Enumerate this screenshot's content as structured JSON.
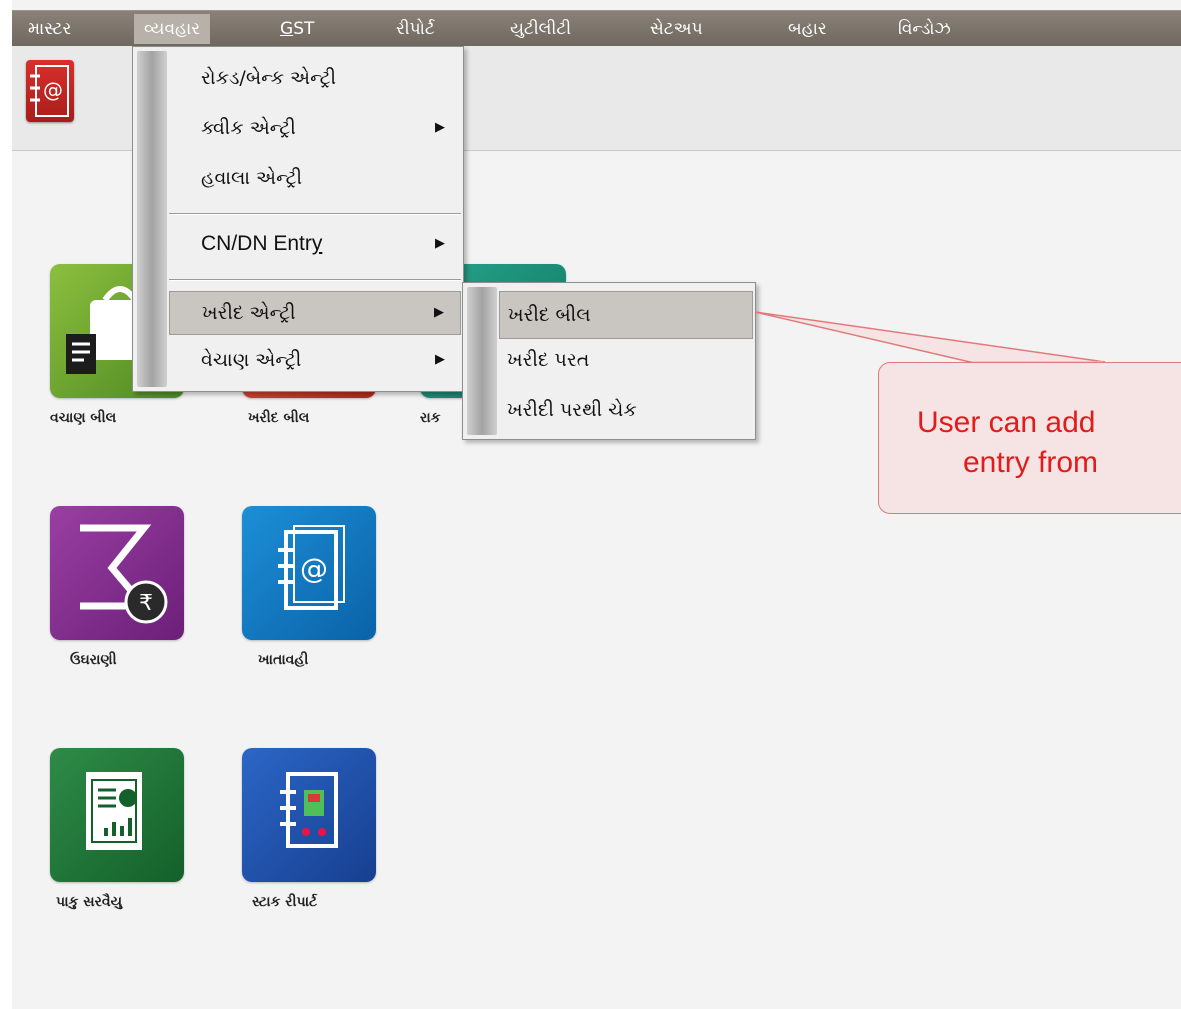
{
  "menubar": {
    "items": [
      "માસ્ટર",
      "વ્યવહાર",
      "GST",
      "રીપોર્ટ",
      "યુટીલીટી",
      "સેટઅપ",
      "બહાર",
      "વિન્ડોઝ"
    ],
    "gst_underline": "G",
    "gst_rest": "ST"
  },
  "main_menu": {
    "items": [
      "રોકડ/બેન્ક એન્ટ્રી",
      "ક્વીક એન્ટ્રી",
      "હવાલા એન્ટ્રી",
      "CN/DN Entry",
      "ખરીદ એન્ટ્રી",
      "વેચાણ એન્ટ્રી"
    ],
    "cndn_prefix": "CN/DN Entr",
    "cndn_underline": "y"
  },
  "submenu": {
    "items": [
      "ખરીદ બીલ",
      "ખરીદ પરત",
      "ખરીદી પરથી ચેક"
    ]
  },
  "desktop": {
    "apps": [
      "વચાણ બીલ",
      "ખરીદ બીલ",
      "રાક",
      "ઉઘરાણી",
      "ખાતાવહી",
      "પાકુ સરવૈયુ",
      "સ્ટાક રીપાર્ટ"
    ]
  },
  "callout": {
    "line1": "User can add",
    "line2": "entry from"
  },
  "colors": {
    "accent_red": "#e01c1c",
    "menubar": "#7c756c"
  }
}
